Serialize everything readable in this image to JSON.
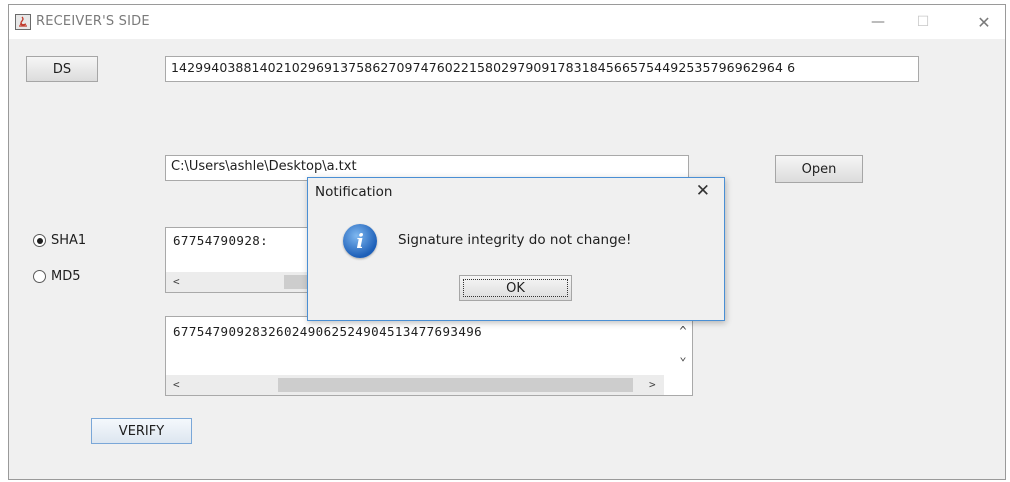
{
  "window": {
    "title": "RECEIVER'S SIDE",
    "minimize_glyph": "—",
    "maximize_glyph": "☐",
    "close_glyph": "✕"
  },
  "ds": {
    "button_label": "DS",
    "value": "1429940388140210296913758627097476022158029790917831845665754492535796962964 6"
  },
  "file": {
    "path": "C:\\Users\\ashle\\Desktop\\a.txt",
    "open_label": "Open"
  },
  "hash_options": [
    {
      "label": "SHA1",
      "selected": true
    },
    {
      "label": "MD5",
      "selected": false
    }
  ],
  "hash_field_1": {
    "value": "67754790928:"
  },
  "hash_field_2": {
    "value": "677547909283260249062524904513477693496"
  },
  "verify": {
    "label": "VERIFY"
  },
  "dialog": {
    "title": "Notification",
    "close_glyph": "✕",
    "message": "Signature integrity do not change!",
    "ok_label": "OK",
    "icon": "info-icon"
  },
  "scroll_glyphs": {
    "left": "<",
    "right": ">",
    "up": "^",
    "down": "⌄"
  }
}
